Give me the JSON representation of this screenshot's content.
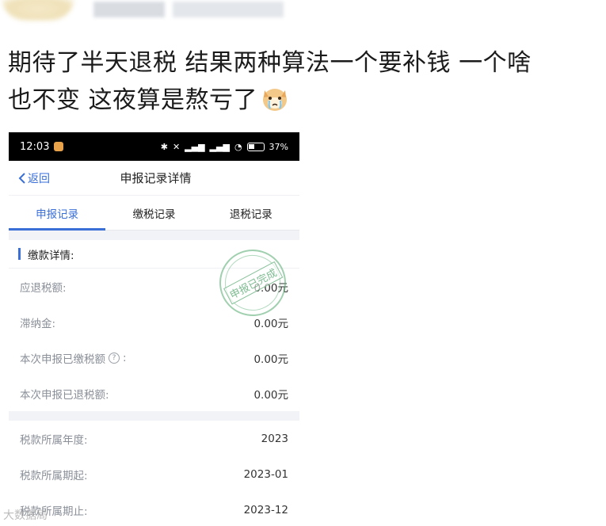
{
  "post": {
    "line1": "期待了半天退税 结果两种算法一个要补钱  一个啥",
    "line2": "也不变 这夜算是熬亏了"
  },
  "status_bar": {
    "time": "12:03",
    "battery": "37%"
  },
  "nav": {
    "back_label": "返回",
    "title": "申报记录详情"
  },
  "tabs": [
    {
      "label": "申报记录",
      "active": true
    },
    {
      "label": "缴税记录",
      "active": false
    },
    {
      "label": "退税记录",
      "active": false
    }
  ],
  "section": {
    "title": "缴款详情:"
  },
  "stamp": {
    "text": "申报已完成"
  },
  "details": [
    {
      "label": "应退税额:",
      "value": "0.00元"
    },
    {
      "label": "滞纳金:",
      "value": "0.00元"
    },
    {
      "label": "本次申报已缴税额",
      "suffix": ":",
      "value": "0.00元"
    },
    {
      "label": "本次申报已退税额:",
      "value": "0.00元"
    }
  ],
  "period": [
    {
      "label": "税款所属年度:",
      "value": "2023"
    },
    {
      "label": "税款所属期起:",
      "value": "2023-01"
    },
    {
      "label": "税款所属期止:",
      "value": "2023-12"
    }
  ],
  "watermark": "大数据局",
  "colors": {
    "accent": "#3a6fd8",
    "stamp": "#48a064"
  }
}
